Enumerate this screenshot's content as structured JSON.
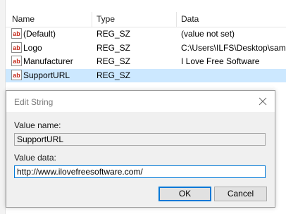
{
  "registry": {
    "columns": [
      "Name",
      "Type",
      "Data"
    ],
    "rows": [
      {
        "name": "(Default)",
        "type": "REG_SZ",
        "data": "(value not set)",
        "icon": "string-value-icon"
      },
      {
        "name": "Logo",
        "type": "REG_SZ",
        "data": "C:\\Users\\ILFS\\Desktop\\samp",
        "icon": "string-value-icon"
      },
      {
        "name": "Manufacturer",
        "type": "REG_SZ",
        "data": "I Love Free Software",
        "icon": "string-value-icon"
      },
      {
        "name": "SupportURL",
        "type": "REG_SZ",
        "data": "",
        "icon": "string-value-icon",
        "selected": true
      }
    ]
  },
  "dialog": {
    "title": "Edit String",
    "value_name_label": "Value name:",
    "value_name": "SupportURL",
    "value_data_label": "Value data:",
    "value_data": "http://www.ilovefreesoftware.com/",
    "ok_label": "OK",
    "cancel_label": "Cancel"
  },
  "colors": {
    "selection": "#cce8ff",
    "accent": "#0078d7",
    "icon_red": "#c42b1c"
  }
}
